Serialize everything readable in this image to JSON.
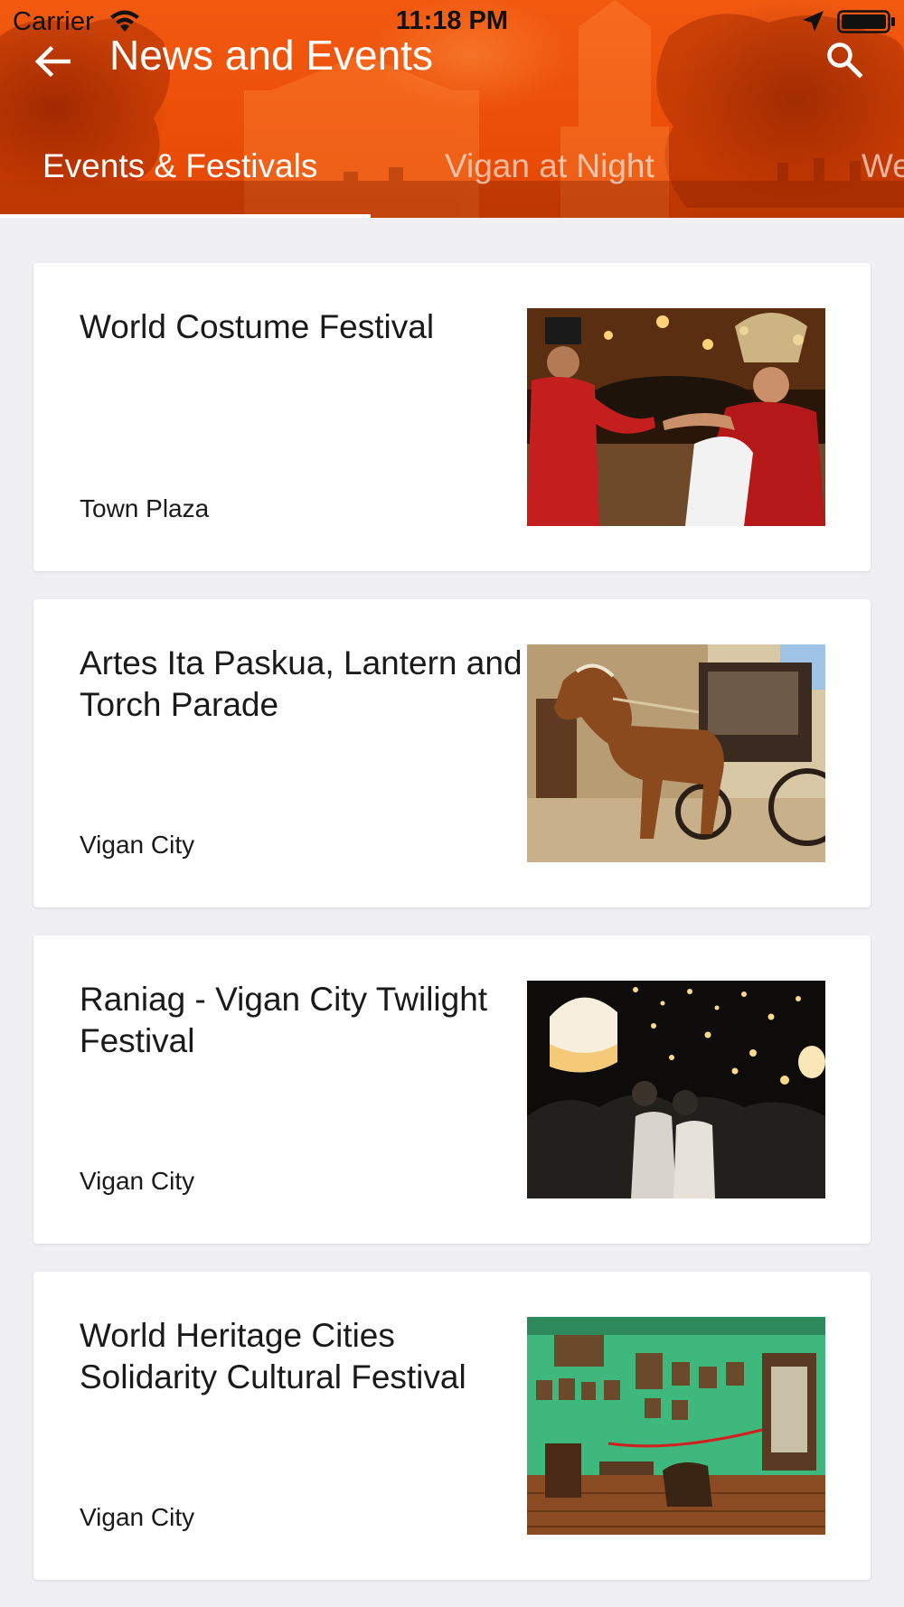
{
  "status_bar": {
    "carrier": "Carrier",
    "time": "11:18 PM",
    "icons": [
      "wifi-icon",
      "location-arrow-icon",
      "battery-icon"
    ]
  },
  "nav": {
    "title": "News and Events",
    "back_icon": "arrow-left-icon",
    "search_icon": "search-icon"
  },
  "tabs": [
    {
      "label": "Events & Festivals",
      "active": true
    },
    {
      "label": "Vigan at Night",
      "active": false
    },
    {
      "label": "We",
      "active": false
    }
  ],
  "events": [
    {
      "title": "World Costume Festival",
      "location": "Town Plaza",
      "image": "costume-festival-photo"
    },
    {
      "title": "Artes Ita Paskua, Lantern and Torch Parade",
      "location": "Vigan City",
      "image": "horse-carriage-photo"
    },
    {
      "title": "Raniag - Vigan City Twilight Festival",
      "location": "Vigan City",
      "image": "sky-lanterns-photo"
    },
    {
      "title": "World Heritage Cities Solidarity Cultural Festival",
      "location": "Vigan City",
      "image": "heritage-room-photo"
    }
  ],
  "colors": {
    "header": "#ec4f08",
    "background": "#efeff4",
    "card": "#ffffff",
    "text": "#1a1a1a"
  }
}
